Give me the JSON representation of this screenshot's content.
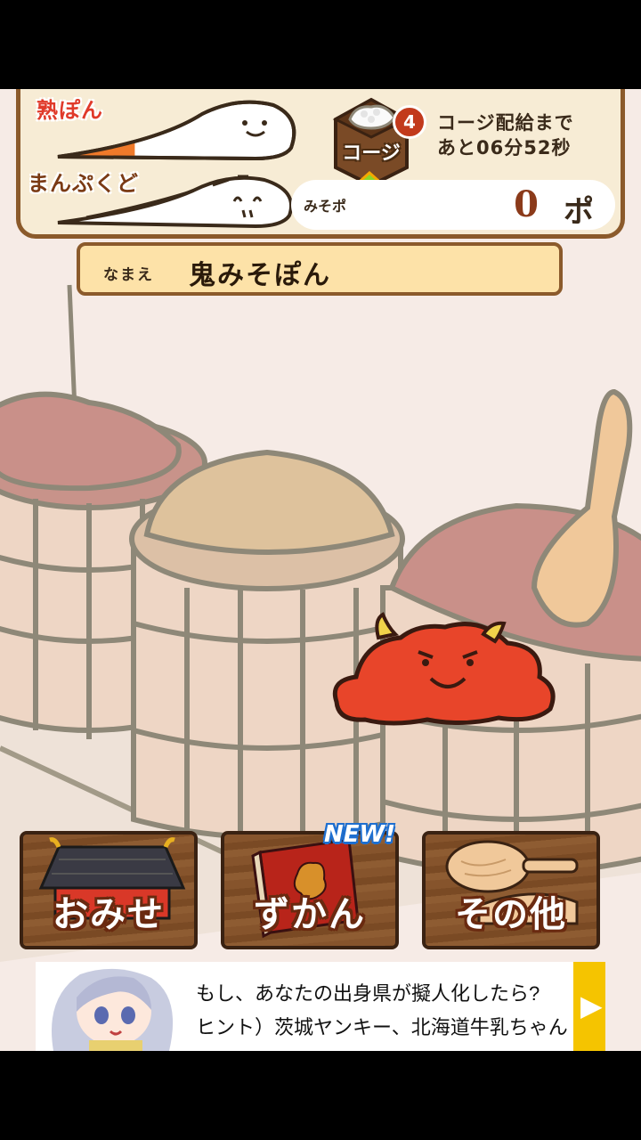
{
  "status": {
    "heat_label": "熟ぽん",
    "heat_level": 0.32,
    "fullness_label": "まんぷくど",
    "fullness_level": 0.0
  },
  "koji": {
    "label": "コージ",
    "count": "4",
    "timer_line1": "コージ配給まで",
    "timer_line2": "あと06分52秒"
  },
  "miso_points": {
    "label": "みそポ",
    "value": "0",
    "unit": "ポ"
  },
  "name": {
    "label": "なまえ",
    "value": "鬼みそぽん"
  },
  "menu": {
    "shop_label": "おみせ",
    "zukan_label": "ずかん",
    "zukan_badge": "NEW!",
    "other_label": "その他"
  },
  "ad": {
    "line1": "もし、あなたの出身県が擬人化したら?",
    "line2": "ヒント）茨城ヤンキー、北海道牛乳ちゃん",
    "arrow": "▶"
  },
  "colors": {
    "heat_fill": "#f07a2a",
    "oni_red": "#e8452a",
    "panel_border": "#8b5a2b",
    "badge_blue": "#1e6fd0"
  }
}
